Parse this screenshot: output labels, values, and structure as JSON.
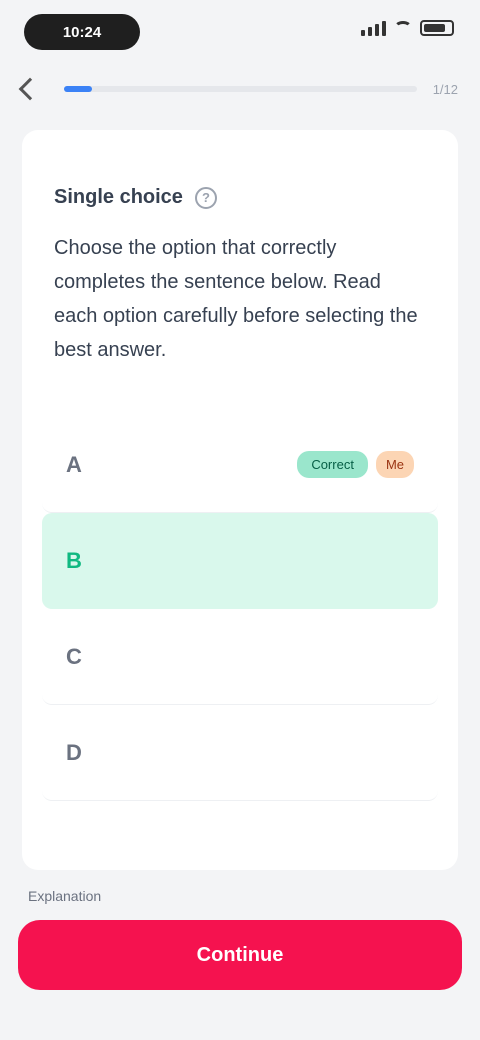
{
  "status": {
    "time": "10:24"
  },
  "nav": {
    "progress_fraction": 0.08,
    "progress_text": "1/12"
  },
  "question": {
    "title": "Single choice",
    "hint": "?",
    "body": "Choose the option that correctly completes the sentence below. Read each option carefully before selecting the best answer."
  },
  "options": [
    {
      "letter": "A",
      "text": "",
      "tags": {
        "correct": "Correct",
        "mine": "Me"
      }
    },
    {
      "letter": "B",
      "text": ""
    },
    {
      "letter": "C",
      "text": ""
    },
    {
      "letter": "D",
      "text": ""
    }
  ],
  "footer": {
    "label": "Explanation",
    "button": "Continue"
  },
  "colors": {
    "accent": "#f5124f",
    "correct_bg": "#d9f8ec",
    "progress": "#3b82f6"
  }
}
